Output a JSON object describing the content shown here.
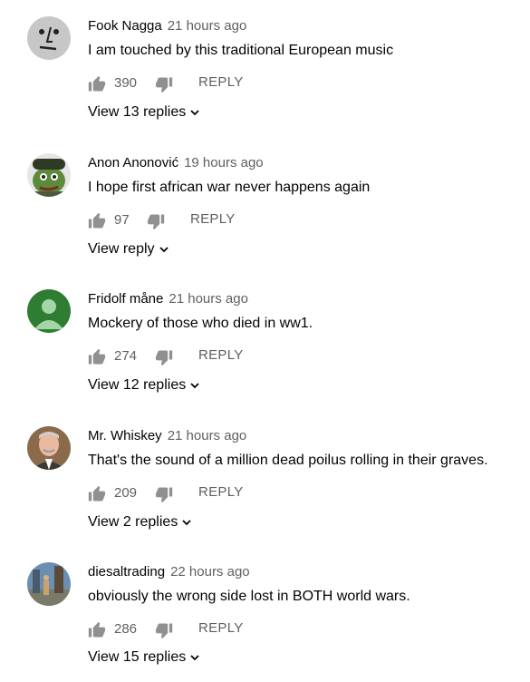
{
  "comments": [
    {
      "author": "Fook Nagga",
      "time": "21 hours ago",
      "text": "I am touched by this traditional European music",
      "likes": "390",
      "reply_label": "REPLY",
      "view_replies": "View 13 replies",
      "avatar": "troll-face-avatar"
    },
    {
      "author": "Anon Anonović",
      "time": "19 hours ago",
      "text": "I hope first african war never happens again",
      "likes": "97",
      "reply_label": "REPLY",
      "view_replies": "View reply",
      "avatar": "pepe-soldier-avatar"
    },
    {
      "author": "Fridolf måne",
      "time": "21 hours ago",
      "text": "Mockery of those who died in ww1.",
      "likes": "274",
      "reply_label": "REPLY",
      "view_replies": "View 12 replies",
      "avatar": "default-user-avatar"
    },
    {
      "author": "Mr. Whiskey",
      "time": "21 hours ago",
      "text": "That's the sound of a million dead poilus rolling in their graves.",
      "likes": "209",
      "reply_label": "REPLY",
      "view_replies": "View 2 replies",
      "avatar": "man-portrait-avatar"
    },
    {
      "author": "diesaltrading",
      "time": "22 hours ago",
      "text": "obviously the wrong side lost in BOTH world wars.",
      "likes": "286",
      "reply_label": "REPLY",
      "view_replies": "View 15 replies",
      "avatar": "street-photo-avatar"
    }
  ],
  "colors": {
    "primary_text": "#030303",
    "secondary_text": "#606060",
    "icon": "#909090"
  }
}
